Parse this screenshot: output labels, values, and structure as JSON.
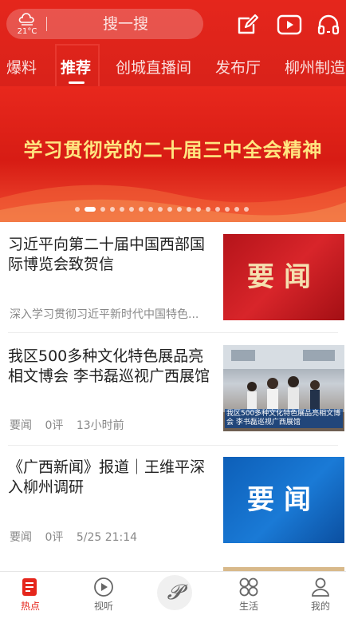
{
  "header": {
    "weather": {
      "temperature": "21°C",
      "icon": "cloud-icon"
    },
    "search": {
      "placeholder": "搜一搜"
    },
    "icons": [
      "edit-icon",
      "video-icon",
      "headphones-icon"
    ]
  },
  "tabs": [
    {
      "label": "爆料",
      "active": false
    },
    {
      "label": "推荐",
      "active": true
    },
    {
      "label": "创城直播间",
      "active": false
    },
    {
      "label": "发布厅",
      "active": false
    },
    {
      "label": "柳州制造",
      "active": false
    }
  ],
  "banner": {
    "text": "学习贯彻党的二十届三中全会精神",
    "slide_count": 18,
    "active_slide": 1
  },
  "news": [
    {
      "title": "习近平向第二十届中国西部国际博览会致贺信",
      "summary": "深入学习贯彻习近平新时代中国特色...",
      "thumb_label": "要闻"
    },
    {
      "title": "我区500多种文化特色展品亮相文博会 李书磊巡视广西展馆",
      "source": "要闻",
      "comments": "0评",
      "time": "13小时前",
      "thumb_caption": "我区500多种文化特色展品亮相文博会 李书磊巡视广西展馆"
    },
    {
      "title": "《广西新闻》报道｜王维平深入柳州调研",
      "source": "要闻",
      "comments": "0评",
      "time": "5/25 21:14",
      "thumb_label": "要闻"
    }
  ],
  "bottom_nav": [
    {
      "label": "热点",
      "icon": "news-icon",
      "active": true
    },
    {
      "label": "视听",
      "icon": "play-icon",
      "active": false
    },
    {
      "label": "",
      "icon": "logo-icon",
      "active": false
    },
    {
      "label": "生活",
      "icon": "grid-icon",
      "active": false
    },
    {
      "label": "我的",
      "icon": "user-icon",
      "active": false
    }
  ],
  "colors": {
    "brand_red": "#e5261c",
    "banner_text": "#ffe680",
    "thumb_blue": "#1a7ad6"
  }
}
